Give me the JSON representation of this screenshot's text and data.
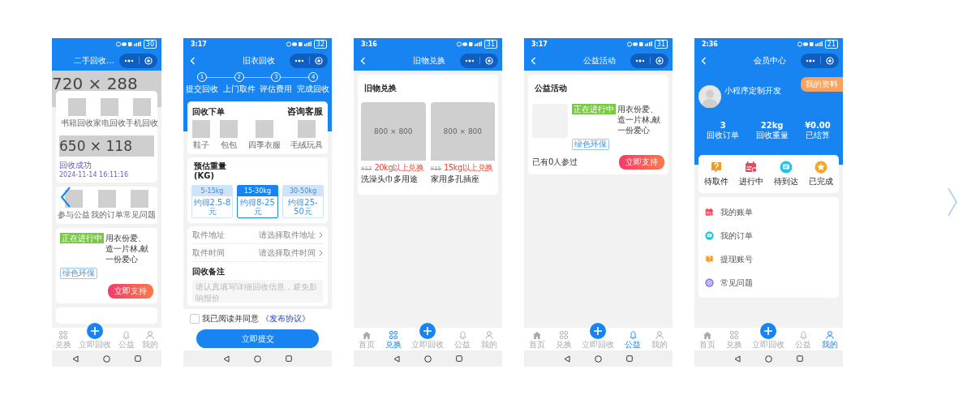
{
  "phones": [
    {
      "kind": "home",
      "status": {
        "battery": "30"
      },
      "nav": {
        "title": "二手回收…",
        "back": false
      },
      "banner": "720 × 288",
      "grid_top": [
        "书籍回收",
        "家电回收",
        "手机回收"
      ],
      "notice": {
        "banner": "650 × 118",
        "status": "回收成功",
        "time": "2024-11-14 16:11:16"
      },
      "grid_bottom": [
        "参与公益",
        "我的订单",
        "常见问题"
      ],
      "activity": {
        "badge": "正在进行中",
        "text": "用衣份爱、造一片林,献一份爱心",
        "tag": "绿色环保",
        "button": "立即支持"
      },
      "tabbar": [
        {
          "label": "兑换",
          "kind": "grid",
          "selected": false
        },
        {
          "label": "立即回收",
          "kind": "center",
          "selected": false
        },
        {
          "label": "公益",
          "kind": "bell",
          "selected": false
        },
        {
          "label": "我的",
          "kind": "user",
          "selected": false
        }
      ]
    },
    {
      "kind": "recycle",
      "status": {
        "time": "3:17",
        "battery": "32"
      },
      "nav": {
        "title": "旧衣回收",
        "back": true
      },
      "steps": [
        {
          "num": "1",
          "label": "提交回收"
        },
        {
          "num": "2",
          "label": "上门取件"
        },
        {
          "num": "3",
          "label": "评估费用"
        },
        {
          "num": "4",
          "label": "完成回收"
        }
      ],
      "order": {
        "title": "回收下单",
        "link": "咨询客服",
        "items": [
          "鞋子",
          "包包",
          "四季衣服",
          "毛绒玩具"
        ]
      },
      "weight": {
        "title": "预估重量 (KG)",
        "options": [
          {
            "range": "5-15kg",
            "price": "约得2.5-8元",
            "selected": false
          },
          {
            "range": "15-30kg",
            "price": "约得8-25元",
            "selected": true
          },
          {
            "range": "30-50kg",
            "price": "约得25-50元",
            "selected": false
          }
        ]
      },
      "rows": [
        {
          "label": "取件地址",
          "placeholder": "请选择取件地址"
        },
        {
          "label": "取件时间",
          "placeholder": "请选择取件时间"
        }
      ],
      "remark": {
        "label": "回收备注",
        "placeholder": "请认真填写详细回收信息，避免影响报价"
      },
      "agree": {
        "checked": false,
        "text": "我已阅读并同意",
        "link": "《发布协议》"
      },
      "submit": "立即提交"
    },
    {
      "kind": "exchange",
      "status": {
        "time": "3:16",
        "battery": "31"
      },
      "nav": {
        "title": "旧物兑换",
        "back": true
      },
      "title": "旧物兑换",
      "products": [
        {
          "image": "800 × 800",
          "price": "¥12",
          "condition": "20kg以上兑换",
          "name": "洗澡头巾多用途"
        },
        {
          "image": "800 × 800",
          "price": "¥15",
          "condition": "15kg以上兑换",
          "name": "家用多孔插座"
        }
      ],
      "tabbar": [
        {
          "label": "首页",
          "kind": "home",
          "selected": false
        },
        {
          "label": "兑换",
          "kind": "grid",
          "selected": true
        },
        {
          "label": "立即回收",
          "kind": "center",
          "selected": false
        },
        {
          "label": "公益",
          "kind": "bell",
          "selected": false
        },
        {
          "label": "我的",
          "kind": "user",
          "selected": false
        }
      ]
    },
    {
      "kind": "charity",
      "status": {
        "time": "3:17",
        "battery": "31"
      },
      "nav": {
        "title": "公益活动",
        "back": true
      },
      "title": "公益活动",
      "activity": {
        "badge": "正在进行中",
        "text": "用衣份爱、造一片林,献一份爱心",
        "tag": "绿色环保",
        "participants": "已有0人参过",
        "button": "立即支持"
      },
      "tabbar": [
        {
          "label": "首页",
          "kind": "home",
          "selected": false
        },
        {
          "label": "兑换",
          "kind": "grid",
          "selected": false
        },
        {
          "label": "立即回收",
          "kind": "center",
          "selected": false
        },
        {
          "label": "公益",
          "kind": "bell",
          "selected": true
        },
        {
          "label": "我的",
          "kind": "user",
          "selected": false
        }
      ]
    },
    {
      "kind": "member",
      "status": {
        "time": "2:36",
        "battery": "21"
      },
      "nav": {
        "title": "会员中心",
        "back": true
      },
      "profile": {
        "name": "小程序定制开发",
        "button": "我的资料"
      },
      "stats": [
        {
          "value": "3",
          "label": "回收订单"
        },
        {
          "value": "22kg",
          "label": "回收重量"
        },
        {
          "value": "¥0.00",
          "label": "已结算"
        }
      ],
      "orders": [
        {
          "label": "待取件",
          "kind": "question"
        },
        {
          "label": "进行中",
          "kind": "calendar"
        },
        {
          "label": "待到达",
          "kind": "message"
        },
        {
          "label": "已完成",
          "kind": "star"
        }
      ],
      "menu": [
        {
          "label": "我的账单",
          "kind": "calendar"
        },
        {
          "label": "我的订单",
          "kind": "message"
        },
        {
          "label": "提现账号",
          "kind": "question"
        },
        {
          "label": "常见问题",
          "kind": "target"
        }
      ],
      "tabbar": [
        {
          "label": "首页",
          "kind": "home",
          "selected": false
        },
        {
          "label": "兑换",
          "kind": "grid",
          "selected": false
        },
        {
          "label": "立即回收",
          "kind": "center",
          "selected": false
        },
        {
          "label": "公益",
          "kind": "bell",
          "selected": false
        },
        {
          "label": "我的",
          "kind": "user",
          "selected": true
        }
      ]
    }
  ]
}
